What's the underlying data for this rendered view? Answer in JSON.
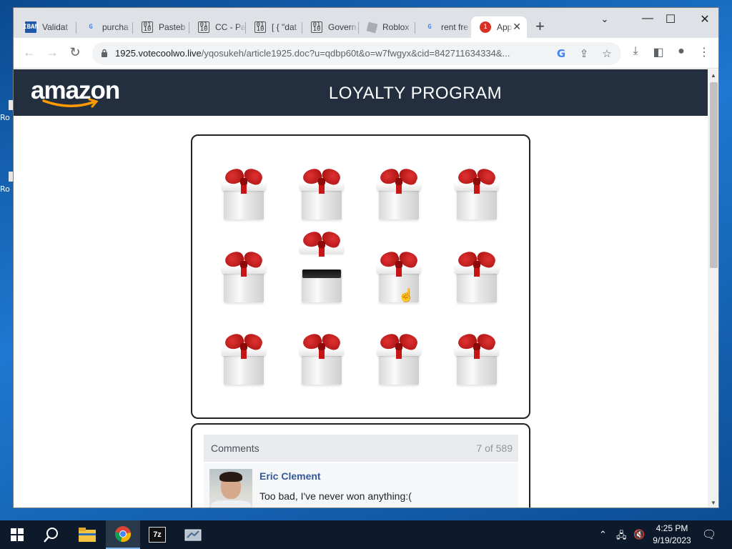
{
  "desktop": {
    "icons": [
      {
        "label": "Ro"
      },
      {
        "label": "Ro"
      }
    ]
  },
  "browser": {
    "tabs": [
      {
        "title": "Validat",
        "icon": "iban-icon"
      },
      {
        "title": "purcha",
        "icon": "google-icon"
      },
      {
        "title": "Pasteb",
        "icon": "document-icon"
      },
      {
        "title": "CC - Pa",
        "icon": "document-icon"
      },
      {
        "title": "[ { \"dat",
        "icon": "document-icon"
      },
      {
        "title": "Govern",
        "icon": "document-icon"
      },
      {
        "title": "Roblox",
        "icon": "roblox-icon"
      },
      {
        "title": "rent fre",
        "icon": "google-icon"
      },
      {
        "title": "App",
        "icon": "alert-icon",
        "badge": "1",
        "active": true
      }
    ],
    "url_host": "1925.votecoolwo.live",
    "url_path": "/yqosukeh/article1925.doc?u=qdbp60t&o=w7fwgyx&cid=842711634334&..."
  },
  "page": {
    "brand": "amazon",
    "header_title": "LOYALTY PROGRAM",
    "gifts": [
      {
        "state": "closed"
      },
      {
        "state": "closed"
      },
      {
        "state": "closed"
      },
      {
        "state": "closed"
      },
      {
        "state": "closed"
      },
      {
        "state": "opened"
      },
      {
        "state": "closed"
      },
      {
        "state": "closed"
      },
      {
        "state": "closed"
      },
      {
        "state": "closed"
      },
      {
        "state": "closed"
      },
      {
        "state": "closed"
      }
    ],
    "comments": {
      "title": "Comments",
      "count": "7 of 589",
      "items": [
        {
          "author": "Eric Clement",
          "text": "Too bad, I've never won anything:("
        }
      ]
    }
  },
  "taskbar": {
    "time": "4:25 PM",
    "date": "9/19/2023",
    "apps": [
      "file-explorer-icon",
      "chrome-icon",
      "7zip-icon",
      "network-app-icon"
    ]
  },
  "colors": {
    "header_bg": "#232f3e",
    "brand_smile": "#ff9900",
    "ribbon": "#c81414",
    "link": "#365899"
  }
}
